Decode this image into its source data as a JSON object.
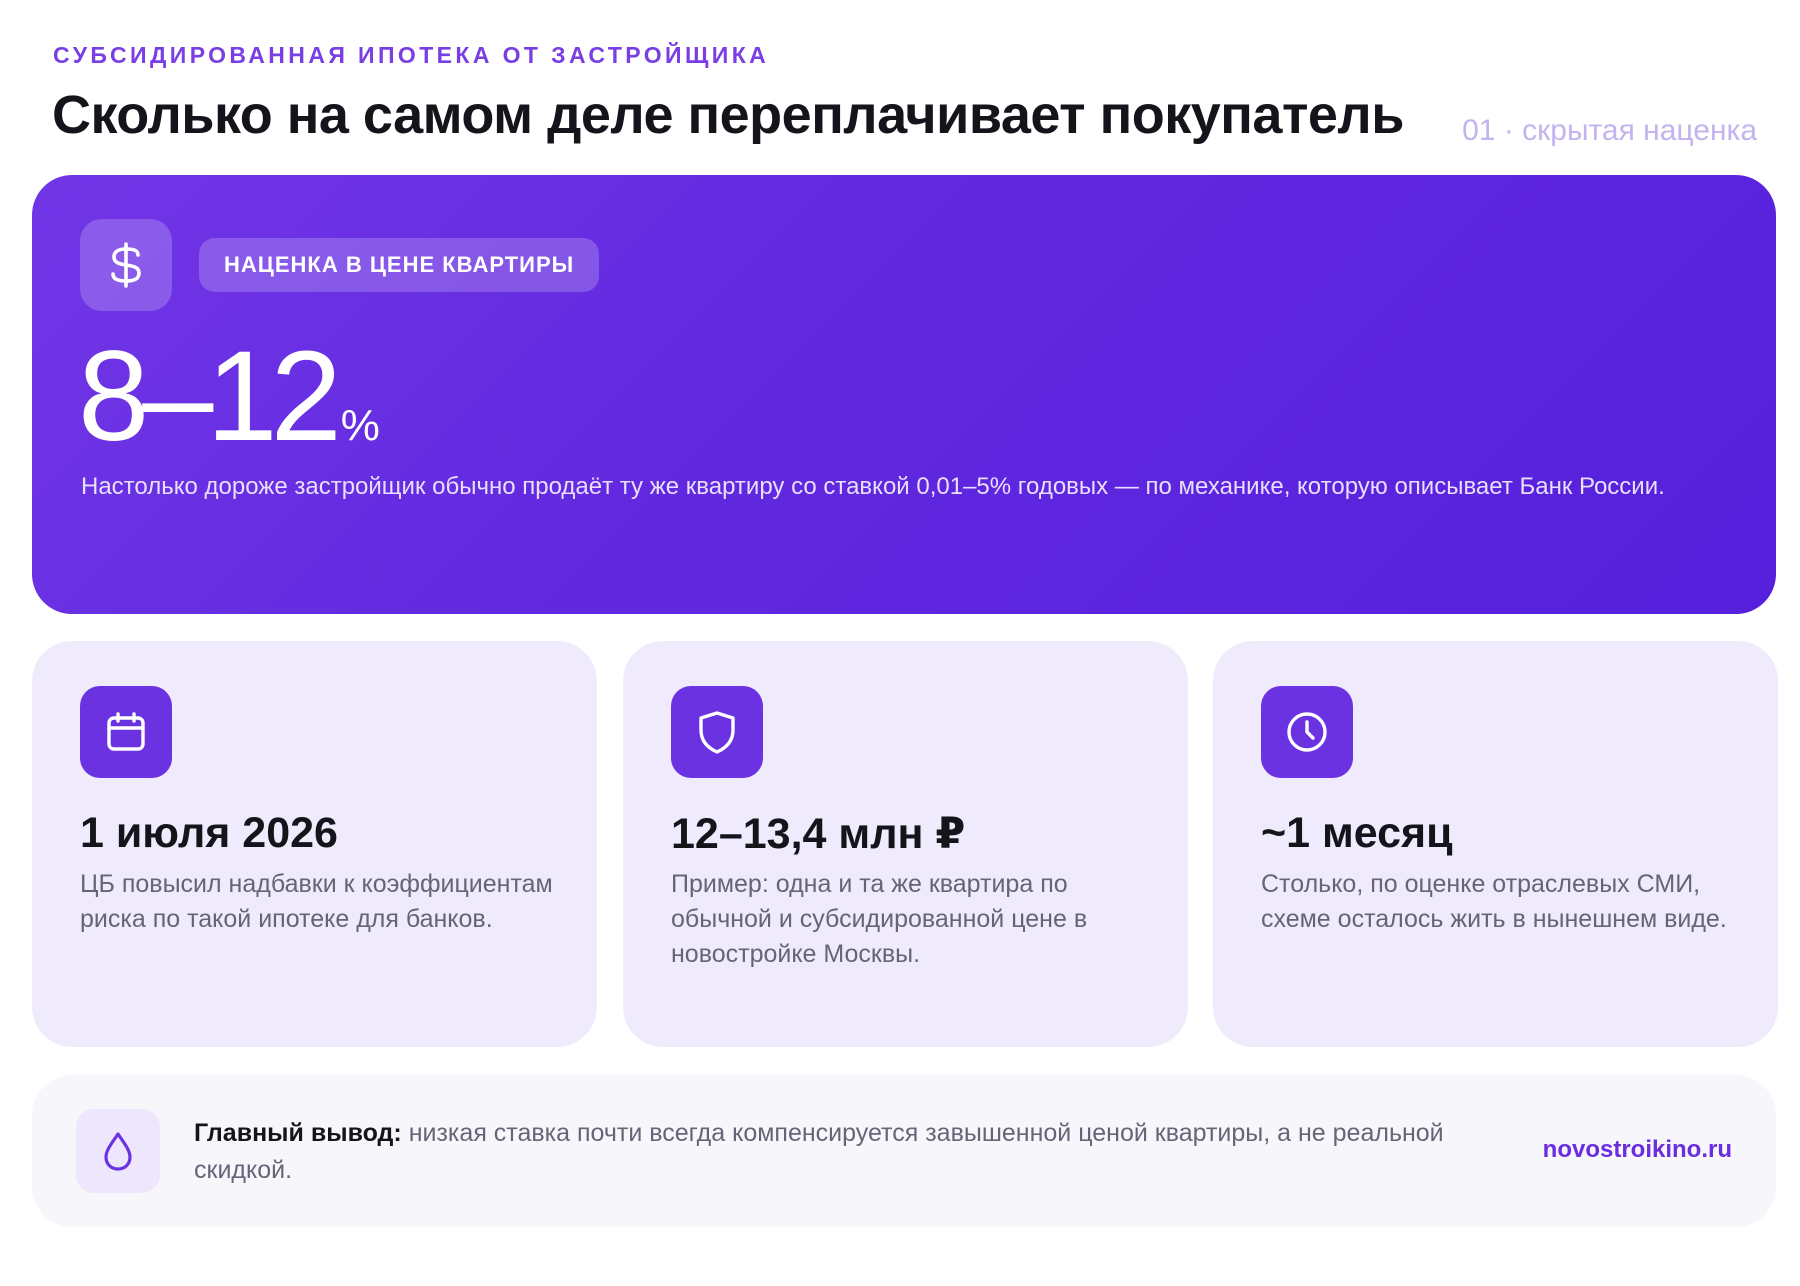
{
  "header": {
    "kicker": "СУБСИДИРОВАННАЯ ИПОТЕКА ОТ ЗАСТРОЙЩИКА",
    "title": "Сколько на самом деле переплачивает покупатель",
    "section_tag": "01 · скрытая наценка"
  },
  "hero": {
    "icon": "dollar-icon",
    "badge": "НАЦЕНКА В ЦЕНЕ КВАРТИРЫ",
    "value": "8–12",
    "unit": "%",
    "description": "Настолько дороже застройщик обычно продаёт ту же квартиру со ставкой 0,01–5% годовых — по механике, которую описывает Банк России."
  },
  "cards": [
    {
      "icon": "calendar-icon",
      "value": "1 июля 2026",
      "text": "ЦБ повысил надбавки к коэффициентам риска по такой ипотеке для банков."
    },
    {
      "icon": "shield-icon",
      "value": "12–13,4 млн ₽",
      "text": "Пример: одна и та же квартира по обычной и субсидированной цене в новостройке Москвы."
    },
    {
      "icon": "clock-icon",
      "value": "~1 месяц",
      "text": "Столько, по оценке отраслевых СМИ, схеме осталось жить в нынешнем виде."
    }
  ],
  "summary": {
    "icon": "drop-icon",
    "label": "Главный вывод:",
    "text": " низкая ставка почти всегда компенсируется завышенной ценой квартиры, а не реальной скидкой.",
    "link": "novostroikino.ru"
  },
  "colors": {
    "accent": "#6b32e1",
    "hero_start": "#7136e6",
    "hero_end": "#5520dc",
    "card_bg": "#f0eafd",
    "summary_bg": "#f7f6fb",
    "muted_text": "#676477",
    "section_tag": "#c3b3ee"
  }
}
